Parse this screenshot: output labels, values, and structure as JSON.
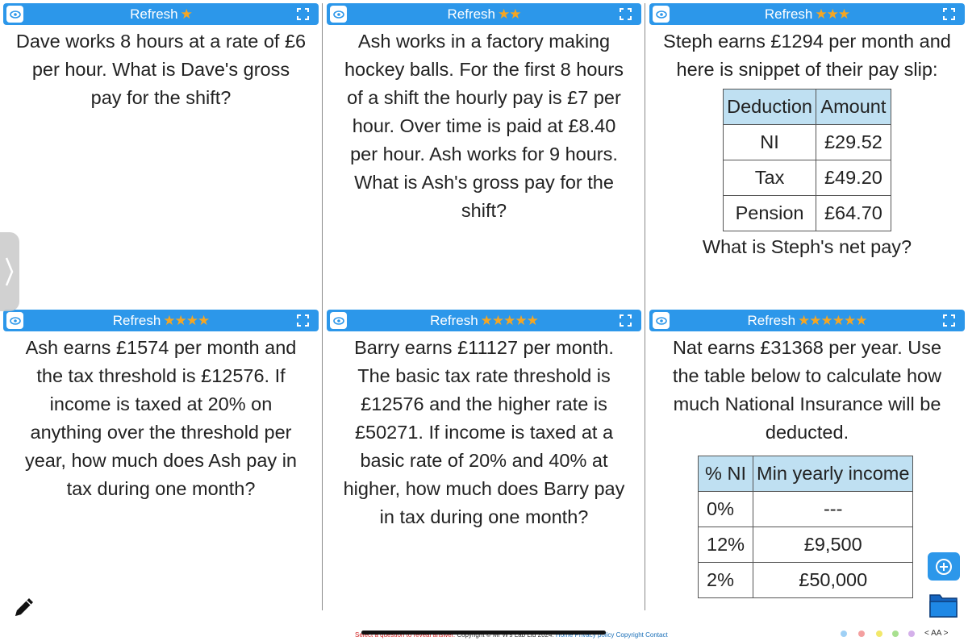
{
  "panels": [
    {
      "refresh_label": "Refresh",
      "stars": "★",
      "lines": [
        "Dave works 8 hours at a rate of £6",
        "per hour. What is Dave's gross",
        "pay for the shift?"
      ]
    },
    {
      "refresh_label": "Refresh",
      "stars": "★★",
      "lines": [
        "Ash works in a factory making",
        "hockey balls. For the first 8 hours",
        "of a shift the hourly pay is £7 per",
        "hour. Over time is paid at £8.40",
        "per hour. Ash works for 9 hours.",
        "What is Ash's gross pay for the",
        "shift?"
      ]
    },
    {
      "refresh_label": "Refresh",
      "stars": "★★★",
      "lines": [
        "Steph earns £1294 per month and",
        "here is snippet of their pay slip:"
      ],
      "table": {
        "headers": [
          "Deduction",
          "Amount"
        ],
        "rows": [
          [
            "NI",
            "£29.52"
          ],
          [
            "Tax",
            "£49.20"
          ],
          [
            "Pension",
            "£64.70"
          ]
        ]
      },
      "after": "What is Steph's net pay?"
    },
    {
      "refresh_label": "Refresh",
      "stars": "★★★★",
      "lines": [
        "Ash earns £1574 per month and",
        "the tax threshold is £12576. If",
        "income is taxed at 20% on",
        "anything over the threshold per",
        "year, how much does Ash pay in",
        "tax during one month?"
      ]
    },
    {
      "refresh_label": "Refresh",
      "stars": "★★★★★",
      "lines": [
        "Barry earns £11127 per month.",
        "The basic tax rate threshold is",
        "£12576 and the higher rate is",
        "£50271. If income is taxed at a",
        "basic rate of 20% and 40% at",
        "higher, how much does Barry pay",
        "in tax during one month?"
      ]
    },
    {
      "refresh_label": "Refresh",
      "stars": "★★★★★★",
      "lines": [
        "Nat earns £31368 per year. Use",
        "the table below to calculate how",
        "much National Insurance will be",
        "deducted."
      ],
      "table": {
        "headers": [
          "% NI",
          "Min yearly income"
        ],
        "rows": [
          [
            "0%",
            "---"
          ],
          [
            "12%",
            "£9,500"
          ],
          [
            "2%",
            "£50,000"
          ]
        ]
      }
    }
  ],
  "footer": {
    "notice": "Select a question to reveal answer.",
    "copyright": "Copyright © Mr W's Lab Ltd 2024.",
    "home": "Home",
    "privacy": "Privacy policy",
    "copyright_link": "Copyright",
    "contact": "Contact",
    "zoom": "< AA >"
  },
  "colors": {
    "accent": "#2c97ea",
    "star": "#f5a623",
    "table_header": "#bfe0f2"
  },
  "icons": {
    "eye": "eye-icon",
    "expand": "expand-icon",
    "pencil": "pencil-icon",
    "add": "plus-circle-icon",
    "folder": "folder-icon",
    "side": "chevron-right-icon"
  }
}
